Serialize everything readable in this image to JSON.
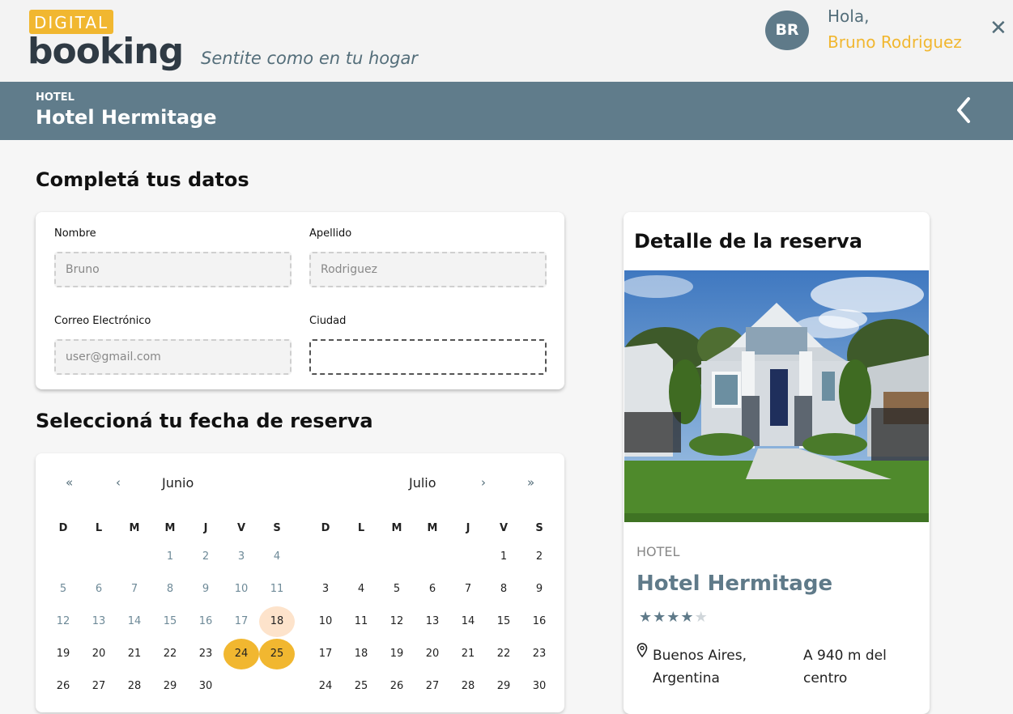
{
  "header": {
    "logo_top": "DIGITAL",
    "logo_bottom": "booking",
    "tagline": "Sentite como en tu hogar",
    "avatar_initials": "BR",
    "greeting": "Hola,",
    "user_name": "Bruno Rodriguez",
    "close_label": "✕"
  },
  "subheader": {
    "category": "HOTEL",
    "title": "Hotel Hermitage"
  },
  "form": {
    "heading": "Completá tus datos",
    "nombre_label": "Nombre",
    "nombre_value": "Bruno",
    "apellido_label": "Apellido",
    "apellido_value": "Rodriguez",
    "correo_label": "Correo Electrónico",
    "correo_value": "user@gmail.com",
    "ciudad_label": "Ciudad",
    "ciudad_value": ""
  },
  "calendar": {
    "heading": "Seleccioná tu fecha de reserva",
    "nav_first": "«",
    "nav_prev": "‹",
    "nav_next": "›",
    "nav_last": "»",
    "weekdays": [
      "D",
      "L",
      "M",
      "M",
      "J",
      "V",
      "S"
    ],
    "months": [
      {
        "name": "Junio",
        "weeks": [
          [
            "",
            "",
            "",
            "1",
            "2",
            "3",
            "4"
          ],
          [
            "5",
            "6",
            "7",
            "8",
            "9",
            "10",
            "11"
          ],
          [
            "12",
            "13",
            "14",
            "15",
            "16",
            "17",
            "18"
          ],
          [
            "19",
            "20",
            "21",
            "22",
            "23",
            "24",
            "25"
          ],
          [
            "26",
            "27",
            "28",
            "29",
            "30",
            "",
            ""
          ]
        ]
      },
      {
        "name": "Julio",
        "weeks": [
          [
            "",
            "",
            "",
            "",
            "",
            "1",
            "2"
          ],
          [
            "3",
            "4",
            "5",
            "6",
            "7",
            "8",
            "9"
          ],
          [
            "10",
            "11",
            "12",
            "13",
            "14",
            "15",
            "16"
          ],
          [
            "17",
            "18",
            "19",
            "20",
            "21",
            "22",
            "23"
          ],
          [
            "24",
            "25",
            "26",
            "27",
            "28",
            "29",
            "30"
          ]
        ]
      }
    ],
    "selected": [
      "24",
      "25"
    ],
    "highlighted": [
      "18"
    ]
  },
  "detail": {
    "heading": "Detalle de la reserva",
    "category": "HOTEL",
    "name": "Hotel Hermitage",
    "rating": 4,
    "rating_max": 5,
    "location": "Buenos Aires, Argentina",
    "distance": "A 940 m del centro"
  },
  "colors": {
    "accent": "#f1b730",
    "primary": "#607c8b",
    "dark": "#2f3a44"
  }
}
